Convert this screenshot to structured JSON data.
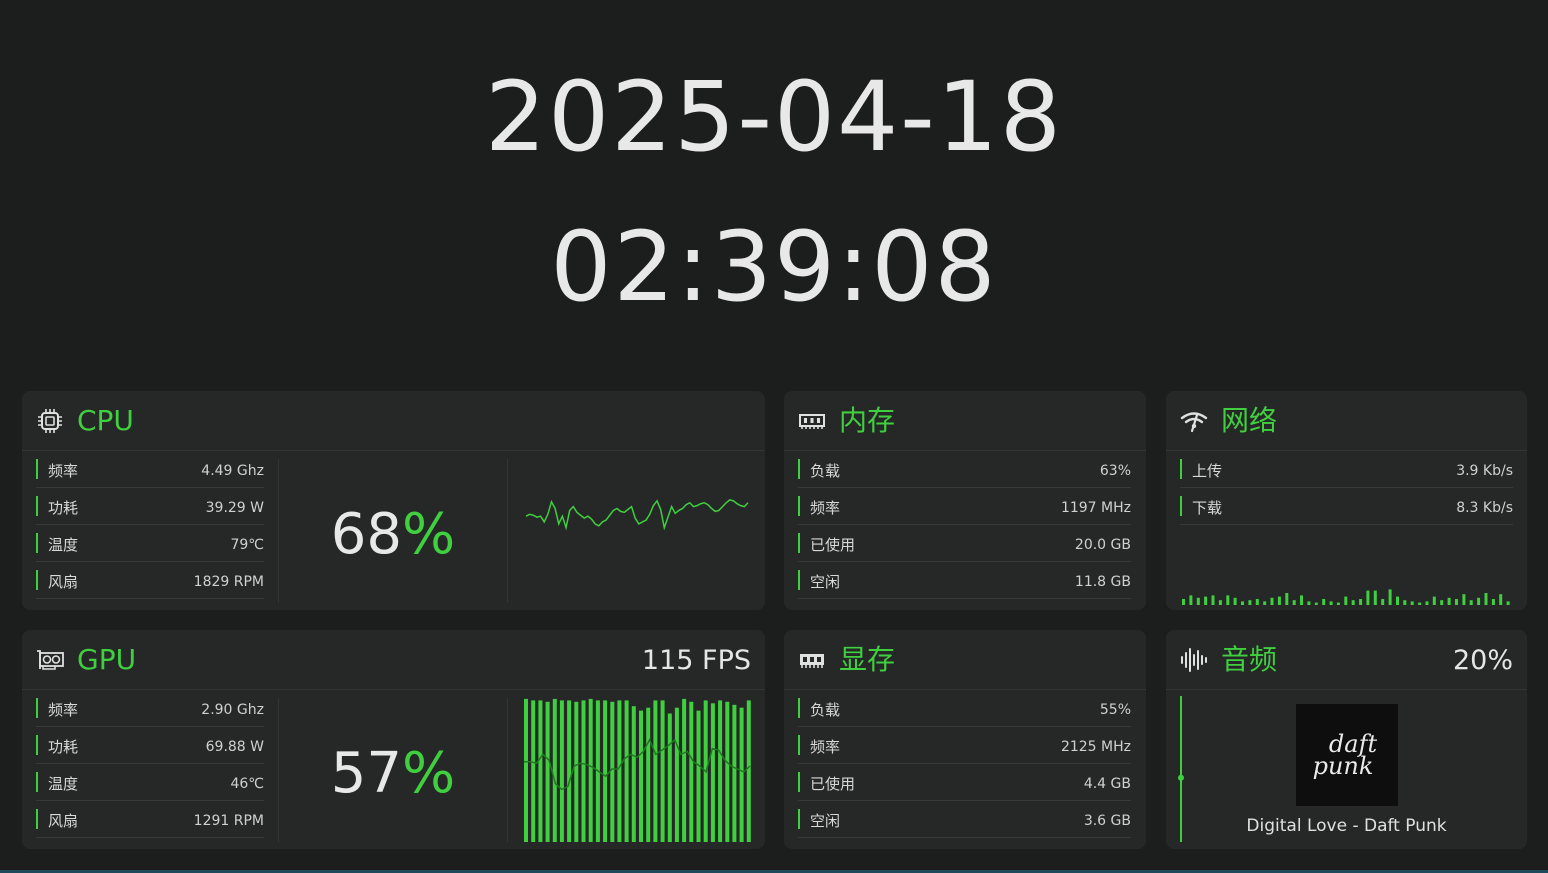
{
  "clock": {
    "date": "2025-04-18",
    "time": "02:39:08"
  },
  "colors": {
    "accent": "#3fcf3f",
    "background": "#1c1d1d",
    "card": "#262727"
  },
  "cpu": {
    "title": "CPU",
    "icon": "cpu-chip-icon",
    "rows": [
      {
        "label": "频率",
        "value": "4.49 Ghz"
      },
      {
        "label": "功耗",
        "value": "39.29 W"
      },
      {
        "label": "温度",
        "value": "79℃"
      },
      {
        "label": "风扇",
        "value": "1829 RPM"
      }
    ],
    "load_number": "68",
    "load_unit": "%",
    "history": [
      30,
      32,
      31,
      29,
      30,
      24,
      32,
      45,
      38,
      22,
      30,
      18,
      36,
      40,
      34,
      31,
      28,
      30,
      27,
      22,
      20,
      24,
      26,
      31,
      36,
      38,
      35,
      34,
      37,
      40,
      28,
      22,
      24,
      26,
      32,
      41,
      46,
      37,
      18,
      29,
      40,
      33,
      36,
      38,
      42,
      44,
      40,
      41,
      43,
      44,
      42,
      38,
      35,
      36,
      40,
      44,
      47,
      46,
      43,
      41,
      40,
      44
    ]
  },
  "memory": {
    "title": "内存",
    "icon": "ram-icon",
    "rows": [
      {
        "label": "负载",
        "value": "63%"
      },
      {
        "label": "频率",
        "value": "1197 MHz"
      },
      {
        "label": "已使用",
        "value": "20.0 GB"
      },
      {
        "label": "空闲",
        "value": "11.8 GB"
      }
    ]
  },
  "network": {
    "title": "网络",
    "icon": "network-signal-icon",
    "rows": [
      {
        "label": "上传",
        "value": "3.9 Kb/s"
      },
      {
        "label": "下载",
        "value": "8.3 Kb/s"
      }
    ],
    "traffic": [
      0.5,
      0.8,
      0.6,
      0.7,
      0.8,
      0.4,
      0.8,
      0.6,
      0.3,
      0.4,
      0.5,
      0.3,
      0.6,
      0.7,
      1.0,
      0.4,
      0.8,
      0.3,
      0.2,
      0.5,
      0.3,
      0.2,
      0.7,
      0.4,
      0.5,
      1.2,
      1.2,
      0.5,
      1.3,
      0.7,
      0.4,
      0.3,
      0.2,
      0.3,
      0.7,
      0.4,
      0.6,
      0.5,
      0.9,
      0.4,
      0.6,
      1.0,
      0.5,
      0.9,
      0.3
    ]
  },
  "gpu": {
    "title": "GPU",
    "icon": "graphics-card-icon",
    "fps": "115 FPS",
    "rows": [
      {
        "label": "频率",
        "value": "2.90 Ghz"
      },
      {
        "label": "功耗",
        "value": "69.88 W"
      },
      {
        "label": "温度",
        "value": "46℃"
      },
      {
        "label": "风扇",
        "value": "1291 RPM"
      }
    ],
    "load_number": "57",
    "load_unit": "%",
    "bars": [
      0.98,
      0.97,
      0.97,
      0.96,
      0.98,
      0.97,
      0.97,
      0.96,
      0.97,
      0.98,
      0.97,
      0.97,
      0.96,
      0.97,
      0.97,
      0.93,
      0.9,
      0.92,
      0.97,
      0.97,
      0.88,
      0.92,
      0.98,
      0.96,
      0.9,
      0.97,
      0.95,
      0.97,
      0.96,
      0.94,
      0.92,
      0.97
    ],
    "line": [
      0.55,
      0.55,
      0.54,
      0.6,
      0.56,
      0.4,
      0.36,
      0.38,
      0.52,
      0.54,
      0.53,
      0.51,
      0.48,
      0.45,
      0.5,
      0.5,
      0.57,
      0.6,
      0.58,
      0.62,
      0.7,
      0.6,
      0.63,
      0.66,
      0.7,
      0.6,
      0.62,
      0.55,
      0.52,
      0.48,
      0.64,
      0.63,
      0.56,
      0.52,
      0.5,
      0.48,
      0.52
    ]
  },
  "vram": {
    "title": "显存",
    "icon": "vram-chip-icon",
    "rows": [
      {
        "label": "负载",
        "value": "55%"
      },
      {
        "label": "频率",
        "value": "2125 MHz"
      },
      {
        "label": "已使用",
        "value": "4.4 GB"
      },
      {
        "label": "空闲",
        "value": "3.6 GB"
      }
    ]
  },
  "audio": {
    "title": "音频",
    "icon": "audio-wave-icon",
    "volume": "20%",
    "volume_level": 0.2,
    "album_art": "daft-punk-album-art",
    "album_text_1": "daft",
    "album_text_2": "punk",
    "song": "Digital Love - Daft Punk"
  }
}
